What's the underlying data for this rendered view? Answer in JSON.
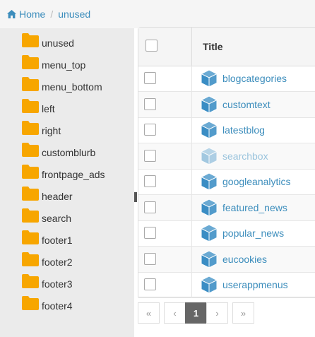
{
  "breadcrumb": {
    "home": "Home",
    "current": "unused"
  },
  "tree": {
    "items": [
      {
        "label": "unused"
      },
      {
        "label": "menu_top"
      },
      {
        "label": "menu_bottom"
      },
      {
        "label": "left"
      },
      {
        "label": "right"
      },
      {
        "label": "customblurb"
      },
      {
        "label": "frontpage_ads"
      },
      {
        "label": "header"
      },
      {
        "label": "search"
      },
      {
        "label": "footer1"
      },
      {
        "label": "footer2"
      },
      {
        "label": "footer3"
      },
      {
        "label": "footer4"
      }
    ]
  },
  "grid": {
    "title_header": "Title",
    "rows": [
      {
        "name": "blogcategories"
      },
      {
        "name": "customtext"
      },
      {
        "name": "latestblog"
      },
      {
        "name": "searchbox",
        "disabled": true
      },
      {
        "name": "googleanalytics"
      },
      {
        "name": "featured_news"
      },
      {
        "name": "popular_news"
      },
      {
        "name": "eucookies"
      },
      {
        "name": "userappmenus"
      }
    ]
  },
  "pager": {
    "first": "«",
    "prev": "‹",
    "page": "1",
    "next": "›",
    "last": "»"
  },
  "colors": {
    "link": "#3c8dbc",
    "folder": "#f7a600",
    "cube": "#3a8dc4"
  }
}
